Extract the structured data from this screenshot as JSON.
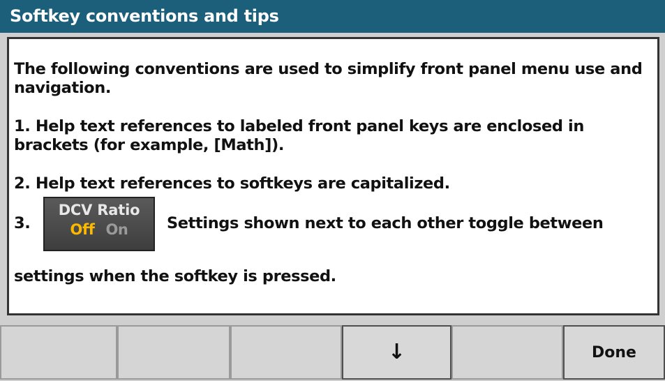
{
  "window": {
    "title": "Softkey conventions and tips"
  },
  "help": {
    "intro": "The following conventions are used to simplify front panel menu use and navigation.",
    "item1": "1. Help text references to labeled front panel keys are enclosed in brackets (for example, [Math]).",
    "item2": "2. Help text references to softkeys are capitalized.",
    "item3_number": "3.",
    "item3_text": "Settings shown next to each other toggle between",
    "item3_continued": "settings when the softkey is pressed.",
    "sample_softkey": {
      "title": "DCV Ratio",
      "option_off": "Off",
      "option_on": "On",
      "selected_color": "#ffb800",
      "unselected_color": "#9a9a9a"
    }
  },
  "softkeys": {
    "key1": "",
    "key2": "",
    "key3": "",
    "key4_icon": "down-arrow-icon",
    "key4_glyph": "↓",
    "key5": "",
    "key6": "Done"
  },
  "colors": {
    "title_bar": "#1b5f7a",
    "pane_background": "#ffffff",
    "softkey_background": "#d5d5d5"
  }
}
